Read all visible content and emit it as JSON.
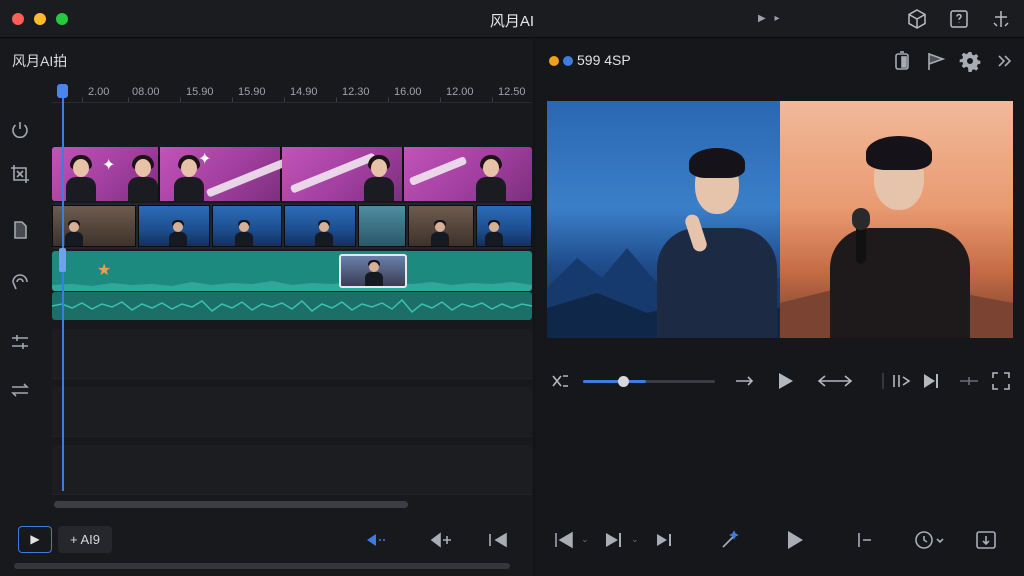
{
  "window": {
    "title": "风月AI"
  },
  "titlebar_icons": [
    "cube-icon",
    "question-box-icon",
    "anchor-icon"
  ],
  "left_panel": {
    "title": "风月AI拍",
    "ruler_ticks": [
      "2.00",
      "08.00",
      "15.90",
      "15.90",
      "14.90",
      "12.30",
      "16.00",
      "12.00",
      "12.50"
    ],
    "tools": [
      "power-icon",
      "crop-icon",
      "mask-icon",
      "swirl-icon",
      "adjust-icon",
      "swap-icon"
    ]
  },
  "bottom_left": {
    "play_label": "▶",
    "add_label": "+ AI9"
  },
  "right_panel": {
    "title": "599 4SP",
    "header_dot_colors": [
      "#f0a020",
      "#3f7ce0"
    ],
    "header_icons": [
      "battery-icon",
      "flag-icon",
      "gear-icon",
      "forward-icon"
    ],
    "scrub_progress": 0.48
  },
  "colors": {
    "accent": "#3f7ce0",
    "clip_magenta": "#b04bab",
    "clip_teal": "#1d8a7f"
  }
}
